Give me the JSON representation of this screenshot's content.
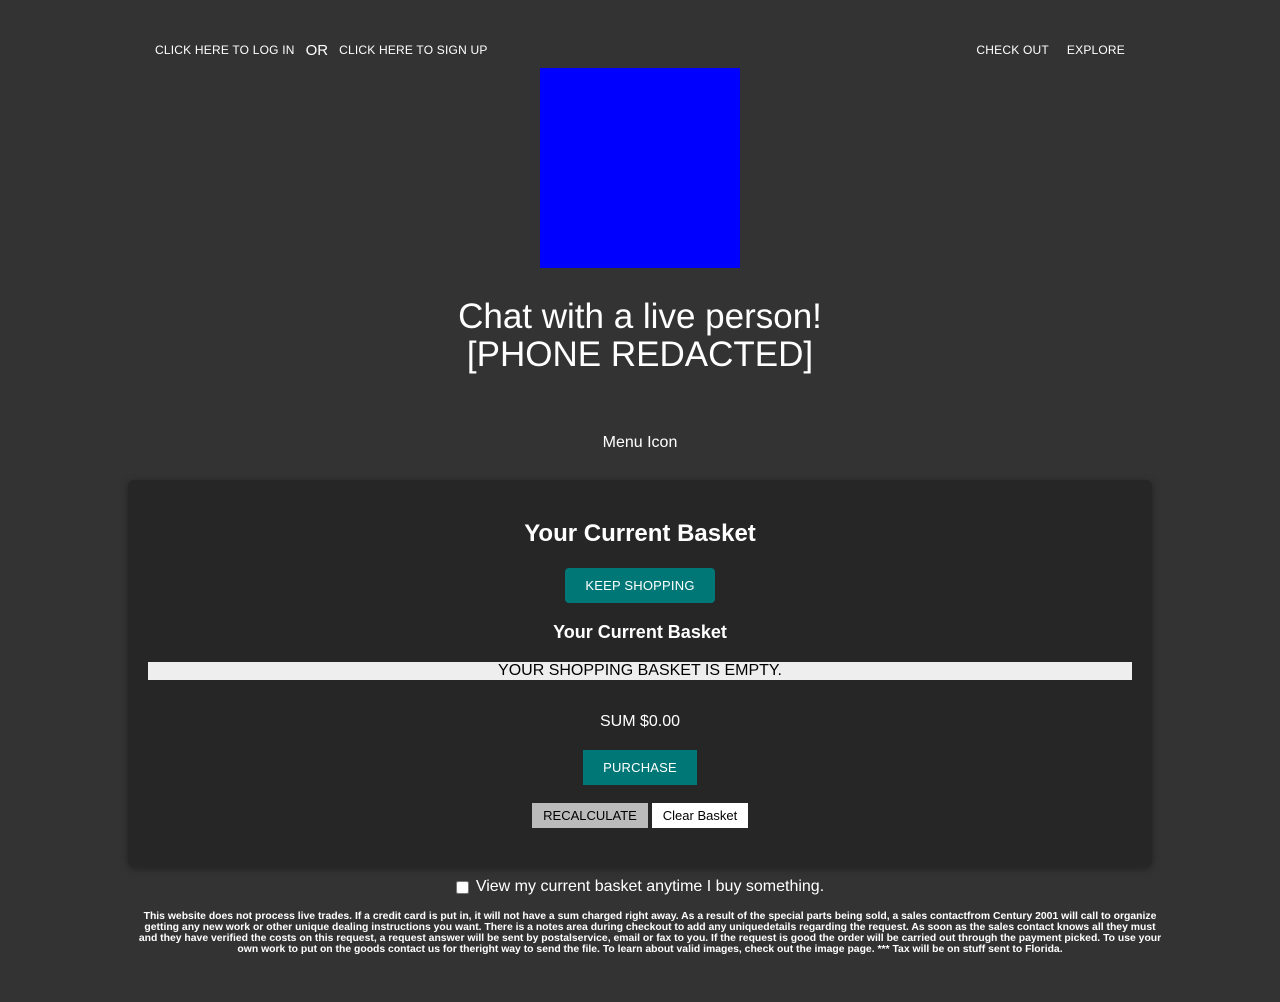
{
  "topbar": {
    "login_label": "Click here to log in",
    "or_label": "OR",
    "signup_label": "Click here to sign up",
    "checkout_label": "Check out",
    "explore_label": "Explore"
  },
  "logo": {
    "color": "#0000ff"
  },
  "chat": {
    "line1": "Chat with a live person!",
    "line2": "[PHONE REDACTED]"
  },
  "menu_icon_label": "Menu Icon",
  "basket": {
    "title": "Your Current Basket",
    "keep_shopping_label": "Keep shopping",
    "subtitle": "Your Current Basket",
    "empty_message": "Your shopping basket is empty.",
    "sum_text": "SUM $0.00",
    "purchase_label": "Purchase",
    "recalculate_label": "Recalculate",
    "clear_label": "Clear Basket"
  },
  "checkbox": {
    "label": "View my current basket anytime I buy something.",
    "checked": false
  },
  "disclaimer": "This website does not process live trades. If a credit card is put in, it will not have a sum charged right away. As a result of the special parts being sold, a sales contactfrom Century 2001 will call to organize getting any new work or other unique dealing instructions you want. There is a notes area during checkout to add any uniquedetails regarding the request. As soon as the sales contact knows all they must and they have verified the costs on this request, a request answer will be sent by postalservice, email or fax to you. If the request is good the order will be carried out through the payment picked. To use your own work to put on the goods contact us for theright way to send the file. To learn about valid images, check out the image page. *** Tax will be on stuff sent to Florida.",
  "colors": {
    "background": "#333333",
    "panel": "#262626",
    "accent": "#007777"
  }
}
